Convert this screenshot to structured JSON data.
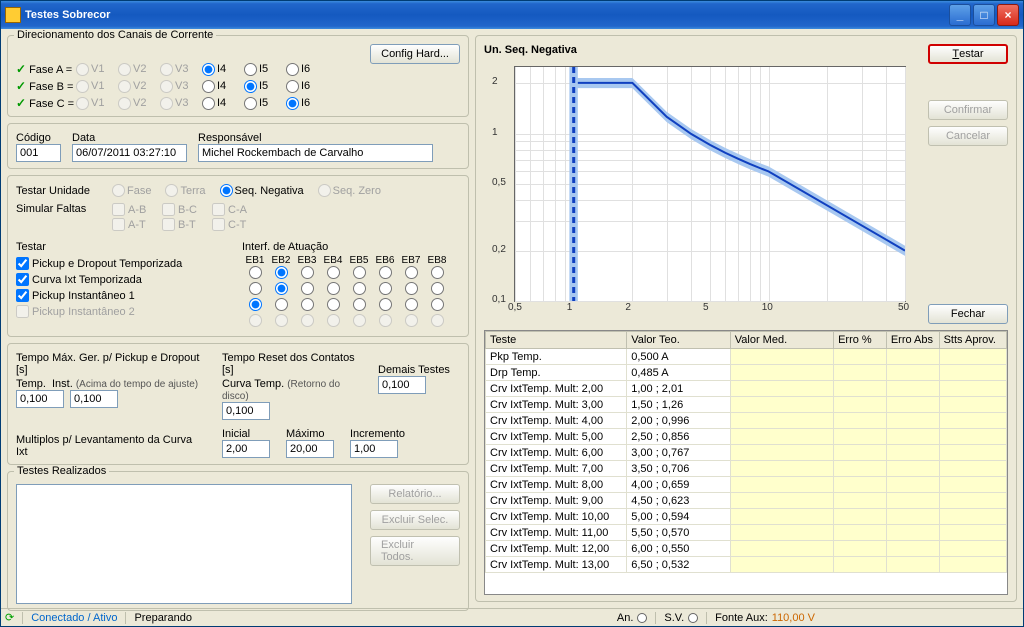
{
  "window": {
    "title": "Testes Sobrecor"
  },
  "left": {
    "group_canais": "Direcionamento dos Canais de Corrente",
    "config_hard": "Config Hard...",
    "phases": [
      "Fase A =",
      "Fase B =",
      "Fase C ="
    ],
    "radio_cols": [
      "V1",
      "V2",
      "V3",
      "I4",
      "I5",
      "I6"
    ],
    "phase_selected": [
      3,
      4,
      5
    ],
    "codigo_lbl": "Código",
    "codigo": "001",
    "data_lbl": "Data",
    "data": "06/07/2011 03:27:10",
    "resp_lbl": "Responsável",
    "resp": "Michel Rockembach de Carvalho",
    "testar_un_lbl": "Testar Unidade",
    "un_opts": [
      "Fase",
      "Terra",
      "Seq. Negativa",
      "Seq. Zero"
    ],
    "simular_lbl": "Simular Faltas",
    "falta_opts": [
      "A-B",
      "B-C",
      "C-A",
      "A-T",
      "B-T",
      "C-T"
    ],
    "testar_lbl": "Testar",
    "interf_lbl": "Interf. de Atuação",
    "eb_cols": [
      "EB1",
      "EB2",
      "EB3",
      "EB4",
      "EB5",
      "EB6",
      "EB7",
      "EB8"
    ],
    "test_items": [
      {
        "label": "Pickup e Dropout Temporizada",
        "checked": true,
        "sel": 1
      },
      {
        "label": "Curva Ixt Temporizada",
        "checked": true,
        "sel": 1
      },
      {
        "label": "Pickup Instantâneo 1",
        "checked": true,
        "sel": 0
      },
      {
        "label": "Pickup Instantâneo 2",
        "checked": false,
        "sel": -1
      }
    ],
    "tempo_max_lbl": "Tempo Máx. Ger. p/ Pickup e Dropout [s]",
    "temp_lbl": "Temp.",
    "temp": "0,100",
    "inst_lbl": "Inst.",
    "inst_note": "(Acima do tempo de ajuste)",
    "inst": "0,100",
    "reset_lbl": "Tempo Reset dos Contatos [s]",
    "curva_temp_lbl": "Curva Temp.",
    "curva_note": "(Retorno do disco)",
    "curva_temp": "0,100",
    "demais_lbl": "Demais Testes",
    "demais": "0,100",
    "mult_lbl": "Multiplos p/ Levantamento da Curva Ixt",
    "inicial_lbl": "Inicial",
    "inicial": "2,00",
    "max_lbl": "Máximo",
    "max": "20,00",
    "inc_lbl": "Incremento",
    "inc": "1,00",
    "realizados_lbl": "Testes Realizados",
    "relatorio": "Relatório...",
    "excl_sel": "Excluir Selec.",
    "excl_tod": "Excluir Todos."
  },
  "right": {
    "chart_title": "Un. Seq. Negativa",
    "testar_btn": "Testar",
    "confirmar": "Confirmar",
    "cancelar": "Cancelar",
    "fechar": "Fechar",
    "table_cols": [
      "Teste",
      "Valor Teo.",
      "Valor Med.",
      "Erro %",
      "Erro Abs",
      "Stts Aprov."
    ],
    "rows": [
      {
        "teste": "Pkp Temp.",
        "teo": "0,500 A"
      },
      {
        "teste": "Drp Temp.",
        "teo": "0,485 A"
      },
      {
        "teste": "Crv IxtTemp. Mult: 2,00",
        "teo": "1,00 ; 2,01"
      },
      {
        "teste": "Crv IxtTemp. Mult: 3,00",
        "teo": "1,50 ; 1,26"
      },
      {
        "teste": "Crv IxtTemp. Mult: 4,00",
        "teo": "2,00 ; 0,996"
      },
      {
        "teste": "Crv IxtTemp. Mult: 5,00",
        "teo": "2,50 ; 0,856"
      },
      {
        "teste": "Crv IxtTemp. Mult: 6,00",
        "teo": "3,00 ; 0,767"
      },
      {
        "teste": "Crv IxtTemp. Mult: 7,00",
        "teo": "3,50 ; 0,706"
      },
      {
        "teste": "Crv IxtTemp. Mult: 8,00",
        "teo": "4,00 ; 0,659"
      },
      {
        "teste": "Crv IxtTemp. Mult: 9,00",
        "teo": "4,50 ; 0,623"
      },
      {
        "teste": "Crv IxtTemp. Mult: 10,00",
        "teo": "5,00 ; 0,594"
      },
      {
        "teste": "Crv IxtTemp. Mult: 11,00",
        "teo": "5,50 ; 0,570"
      },
      {
        "teste": "Crv IxtTemp. Mult: 12,00",
        "teo": "6,00 ; 0,550"
      },
      {
        "teste": "Crv IxtTemp. Mult: 13,00",
        "teo": "6,50 ; 0,532"
      }
    ]
  },
  "chart_data": {
    "type": "line",
    "title": "Un. Seq. Negativa",
    "x_scale": "log",
    "y_scale": "log",
    "xlim": [
      0.5,
      50
    ],
    "ylim": [
      0.1,
      2.5
    ],
    "x_ticks": [
      0.5,
      1,
      2,
      5,
      10,
      50
    ],
    "y_ticks": [
      0.1,
      0.2,
      0.5,
      1,
      2
    ],
    "pickup_vertical": 1.0,
    "series": [
      {
        "name": "curve",
        "x": [
          1,
          2,
          3,
          4,
          5,
          6,
          7,
          8,
          9,
          10,
          50
        ],
        "y": [
          2.01,
          2.01,
          1.26,
          0.996,
          0.856,
          0.767,
          0.706,
          0.659,
          0.623,
          0.594,
          0.2
        ]
      }
    ],
    "band_ratio": 0.07
  },
  "status": {
    "conectado": "Conectado / Ativo",
    "preparando": "Preparando",
    "an": "An.",
    "sv": "S.V.",
    "fonte": "Fonte Aux:",
    "fonte_val": "110,00 V"
  }
}
